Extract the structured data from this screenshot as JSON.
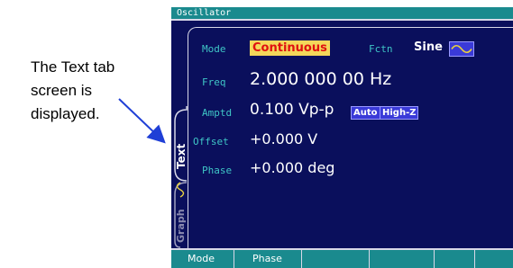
{
  "annotation": {
    "lines": [
      "The Text tab",
      "screen is",
      "displayed."
    ]
  },
  "window": {
    "title": "Oscillator"
  },
  "tabs": [
    {
      "label": "Text",
      "selected": true
    },
    {
      "label": "Graph",
      "selected": false
    }
  ],
  "params": {
    "mode": {
      "label": "Mode",
      "value": "Continuous"
    },
    "fctn": {
      "label": "Fctn",
      "value": "Sine",
      "icon": "sine-wave-icon"
    },
    "freq": {
      "label": "Freq",
      "value": "2.000 000 00 Hz"
    },
    "amptd": {
      "label": "Amptd",
      "value": "0.100 Vp-p",
      "badges": [
        "Auto",
        "High-Z"
      ]
    },
    "offset": {
      "label": "Offset",
      "value": "+0.000 V"
    },
    "phase": {
      "label": "Phase",
      "value": "+0.000 deg"
    }
  },
  "softkeys": [
    "Mode",
    "Phase",
    "",
    "",
    "",
    ""
  ],
  "colors": {
    "screen_bg": "#0a0f5c",
    "title_bar": "#1a8a8e",
    "label": "#3fc6c6",
    "value": "#ffffff",
    "highlight_bg": "#f4d75a",
    "highlight_text": "#e01010",
    "badge_bg": "#3a3ad8"
  }
}
